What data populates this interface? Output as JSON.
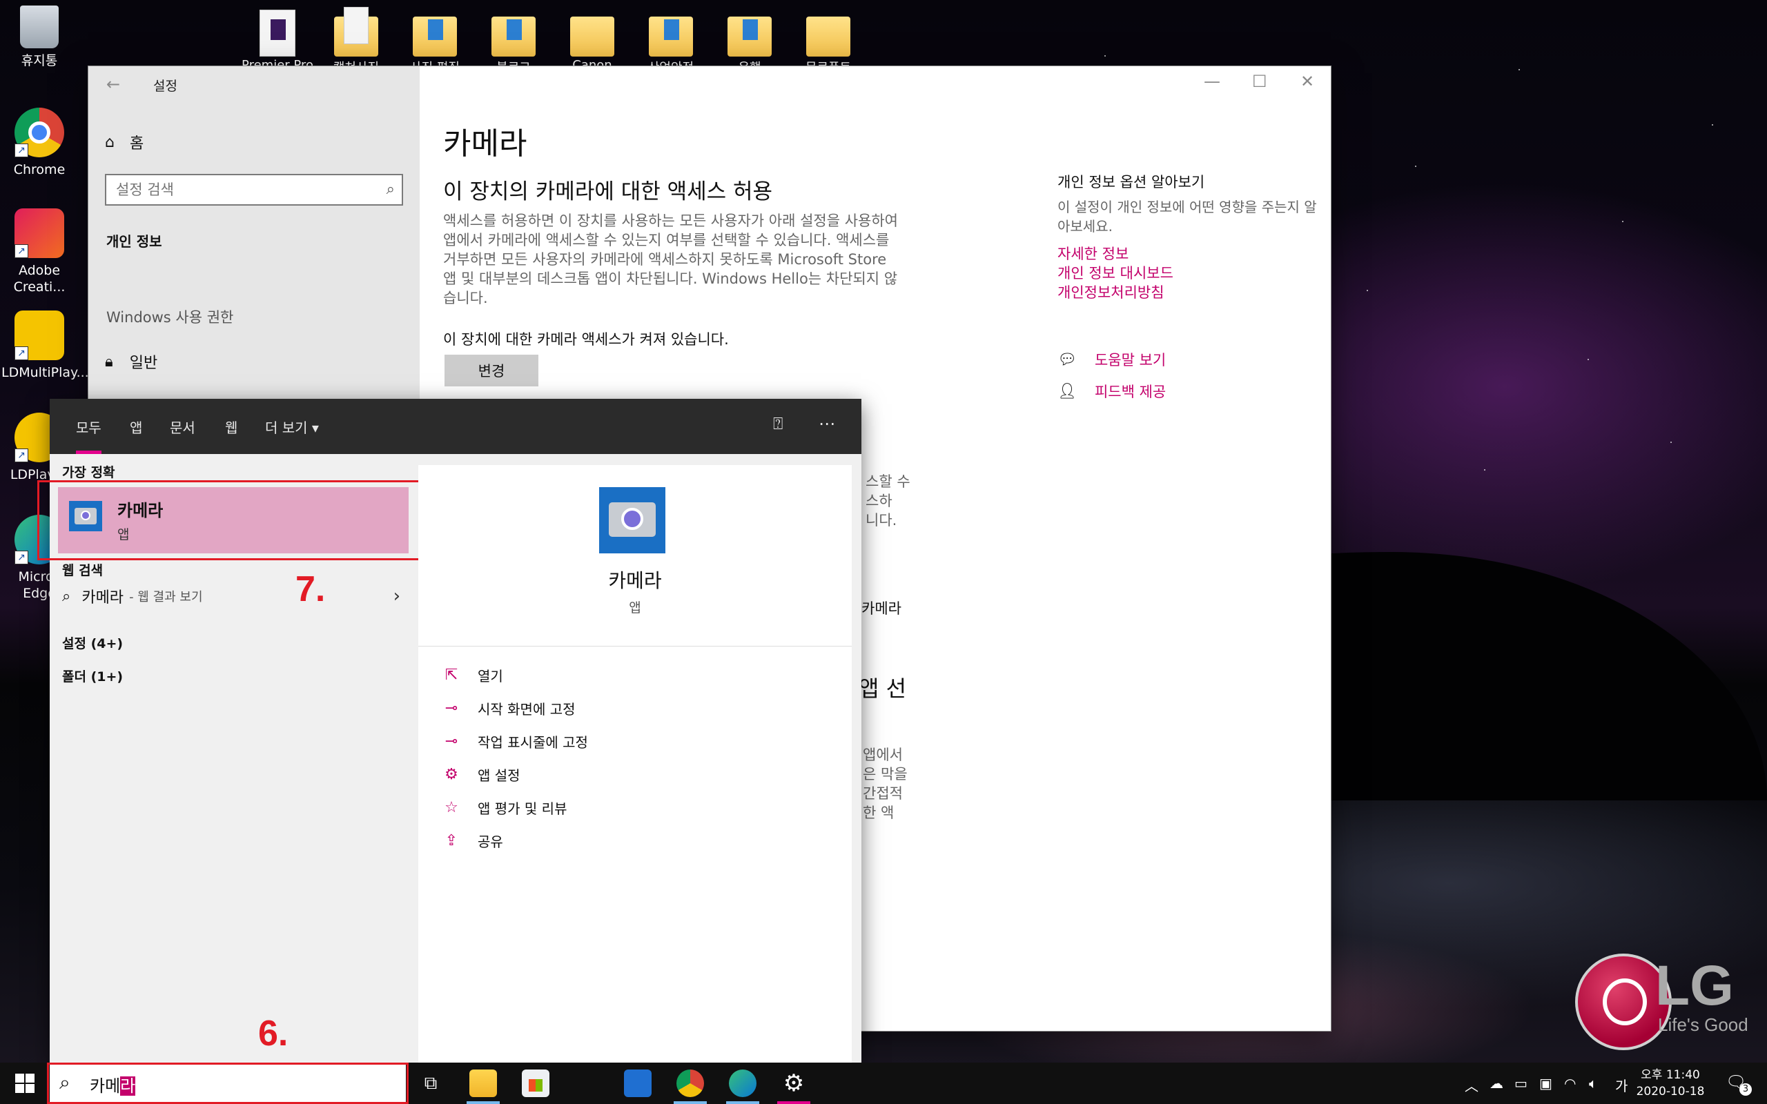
{
  "desktop": {
    "left_icons": [
      {
        "label": "휴지통",
        "icon": "recycle-bin-icon"
      },
      {
        "label": "Chrome",
        "icon": "chrome-icon"
      },
      {
        "label": "Adobe Creati...",
        "icon": "adobe-cc-icon"
      },
      {
        "label": "LDMultiPlay...",
        "icon": "ldmultiplayer-icon"
      },
      {
        "label": "LDPlayer",
        "icon": "ldplayer-icon"
      },
      {
        "label": "Micros Edge",
        "icon": "edge-icon"
      }
    ],
    "top_icons": [
      {
        "label": "Premier Pro",
        "kind": "doc"
      },
      {
        "label": "캡쳐사진",
        "kind": "folder"
      },
      {
        "label": "사진 편집",
        "kind": "folder"
      },
      {
        "label": "블로그",
        "kind": "folder"
      },
      {
        "label": "Canon",
        "kind": "folder"
      },
      {
        "label": "산업안전",
        "kind": "folder"
      },
      {
        "label": "은행",
        "kind": "folder"
      },
      {
        "label": "문로폰트",
        "kind": "folder"
      }
    ],
    "brand": {
      "logo_text": "LG",
      "tagline": "Life's Good"
    }
  },
  "settings_window": {
    "title": "설정",
    "home": "홈",
    "search_placeholder": "설정 검색",
    "group": "개인 정보",
    "permissions_label": "Windows 사용 권한",
    "nav_general": "일반",
    "page_title": "카메라",
    "section_title": "이 장치의 카메라에 대한 액세스 허용",
    "description": "액세스를 허용하면 이 장치를 사용하는 모든 사용자가 아래 설정을 사용하여 앱에서 카메라에 액세스할 수 있는지 여부를 선택할 수 있습니다. 액세스를 거부하면 모든 사용자의 카메라에 액세스하지 못하도록 Microsoft Store 앱 및 대부분의 데스크톱 앱이 차단됩니다. Windows Hello는 차단되지 않습니다.",
    "status": "이 장치에 대한 카메라 액세스가 켜져 있습니다.",
    "change_button": "변경",
    "right": {
      "title": "개인 정보 옵션 알아보기",
      "desc": "이 설정이 개인 정보에 어떤 영향을 주는지 알아보세요.",
      "links": [
        "자세한 정보",
        "개인 정보 대시보드",
        "개인정보처리방침"
      ],
      "help": "도움말 보기",
      "feedback": "피드백 제공"
    },
    "peek_lines": {
      "a": [
        "스할 수",
        "스하",
        "니다."
      ],
      "b": "카메라",
      "c": "앱 선",
      "d": [
        "앱에서",
        "은 막을",
        "간접적",
        "한 액"
      ]
    }
  },
  "search_flyout": {
    "tabs": [
      "모두",
      "앱",
      "문서",
      "웹",
      "더 보기"
    ],
    "best_match_label": "가장 정확",
    "best_match": {
      "name": "카메라",
      "type": "앱"
    },
    "web_label": "웹 검색",
    "web_item": {
      "query": "카메라",
      "suffix": "- 웹 결과 보기"
    },
    "categories": [
      "설정 (4+)",
      "폴더 (1+)"
    ],
    "preview": {
      "name": "카메라",
      "type": "앱",
      "actions": [
        {
          "label": "열기",
          "icon": "open-icon"
        },
        {
          "label": "시작 화면에 고정",
          "icon": "pin-icon"
        },
        {
          "label": "작업 표시줄에 고정",
          "icon": "pin-icon"
        },
        {
          "label": "앱 설정",
          "icon": "gear-icon"
        },
        {
          "label": "앱 평가 및 리뷰",
          "icon": "star-icon"
        },
        {
          "label": "공유",
          "icon": "share-icon"
        }
      ]
    }
  },
  "annotations": {
    "step6": "6.",
    "step7": "7."
  },
  "taskbar": {
    "search_text_plain": "카메",
    "search_text_selected": "라",
    "apps": [
      "task-view-icon",
      "file-explorer-icon",
      "store-icon",
      "mail-icon",
      "chrome-icon",
      "edge-icon",
      "settings-icon"
    ],
    "ime": "가",
    "time": "오후 11:40",
    "date": "2020-10-18",
    "notifications": "3"
  },
  "colors": {
    "accent": "#c3006b",
    "annotation_red": "#e21b25",
    "highlight": "#e2a6c4"
  }
}
